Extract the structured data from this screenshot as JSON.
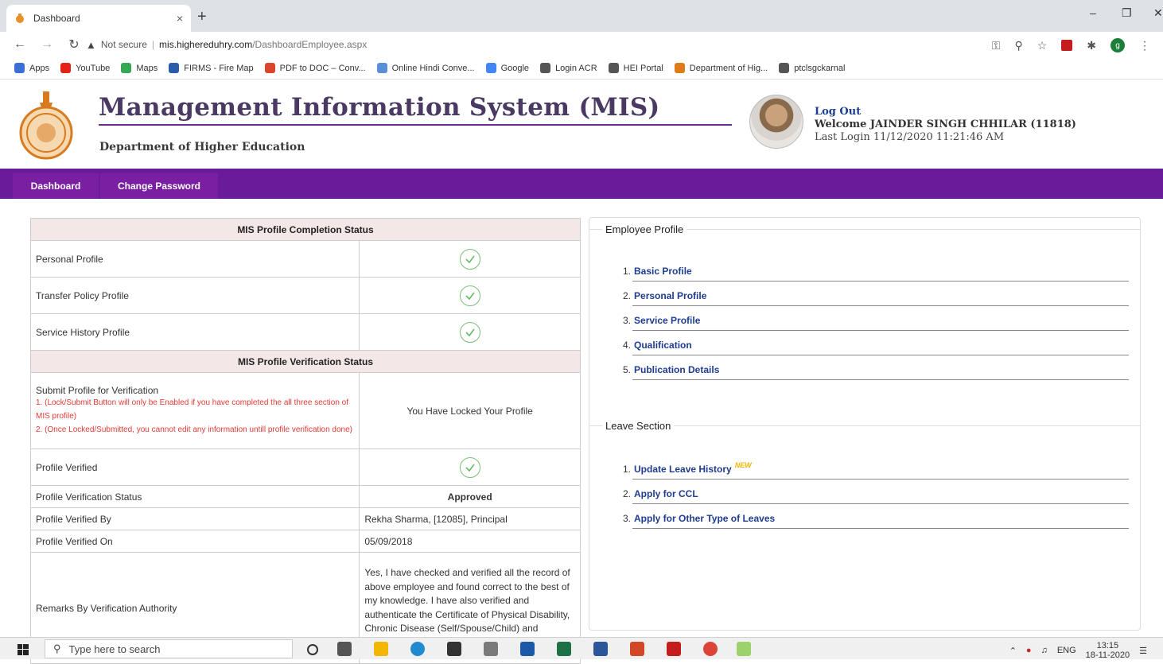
{
  "browser": {
    "tab_title": "Dashboard",
    "tab_close": "×",
    "new_tab": "+",
    "not_secure": "Not secure",
    "url_host": "mis.highereduhry.com",
    "url_path": "/DashboardEmployee.aspx",
    "profile_initial": "g",
    "bookmarks": [
      {
        "label": "Apps",
        "color": "#3b6fd6"
      },
      {
        "label": "YouTube",
        "color": "#e62117"
      },
      {
        "label": "Maps",
        "color": "#34a853"
      },
      {
        "label": "FIRMS - Fire Map",
        "color": "#2b5cab"
      },
      {
        "label": "PDF to DOC – Conv...",
        "color": "#d9462b"
      },
      {
        "label": "Online Hindi Conve...",
        "color": "#5a8fd8"
      },
      {
        "label": "Google",
        "color": "#4285f4"
      },
      {
        "label": "Login ACR",
        "color": "#555555"
      },
      {
        "label": "HEI Portal",
        "color": "#555555"
      },
      {
        "label": "Department of Hig...",
        "color": "#e07b1a"
      },
      {
        "label": "ptclsgckarnal",
        "color": "#555555"
      }
    ]
  },
  "header": {
    "title": "Management Information System (MIS)",
    "department": "Department of Higher Education",
    "logout": "Log Out",
    "welcome": "Welcome JAINDER SINGH CHHILAR (11818)",
    "last_login": "Last Login 11/12/2020 11:21:46 AM"
  },
  "menu": {
    "dashboard": "Dashboard",
    "change_password": "Change Password"
  },
  "completion": {
    "heading": "MIS Profile Completion Status",
    "rows": [
      {
        "label": "Personal Profile"
      },
      {
        "label": "Transfer Policy Profile"
      },
      {
        "label": "Service History Profile"
      }
    ]
  },
  "verification": {
    "heading": "MIS Profile Verification Status",
    "submit_label": "Submit Profile for Verification",
    "note1": "1. (Lock/Submit Button will only be Enabled if you have completed the all three section of MIS profile)",
    "note2": "2. (Once Locked/Submitted, you cannot edit any information untill profile verification done)",
    "locked_text": "You Have Locked Your Profile",
    "verified_label": "Profile Verified",
    "status_label": "Profile Verification Status",
    "status_value": "Approved",
    "by_label": "Profile Verified By",
    "by_value": "Rekha Sharma, [12085], Principal",
    "on_label": "Profile Verified On",
    "on_value": "05/09/2018",
    "remarks_label": "Remarks By Verification Authority",
    "remarks_value": "Yes, I have checked and verified all the record of above employee and found correct to the best of my knowledge. I have also verified and authenticate the Certificate of Physical Disability, Chronic Disease (Self/Spouse/Child) and Mentally Challange Children of the"
  },
  "employee_profile": {
    "legend": "Employee Profile",
    "items": [
      {
        "num": "1.",
        "label": "Basic Profile"
      },
      {
        "num": "2.",
        "label": "Personal Profile"
      },
      {
        "num": "3.",
        "label": "Service Profile"
      },
      {
        "num": "4.",
        "label": "Qualification"
      },
      {
        "num": "5.",
        "label": "Publication Details"
      }
    ]
  },
  "leave_section": {
    "legend": "Leave Section",
    "items": [
      {
        "num": "1.",
        "label": "Update Leave History",
        "badge": "NEW"
      },
      {
        "num": "2.",
        "label": "Apply for CCL"
      },
      {
        "num": "3.",
        "label": "Apply for Other Type of Leaves"
      }
    ]
  },
  "taskbar": {
    "search_placeholder": "Type here to search",
    "lang": "ENG",
    "time": "13:15",
    "date": "18-11-2020"
  }
}
